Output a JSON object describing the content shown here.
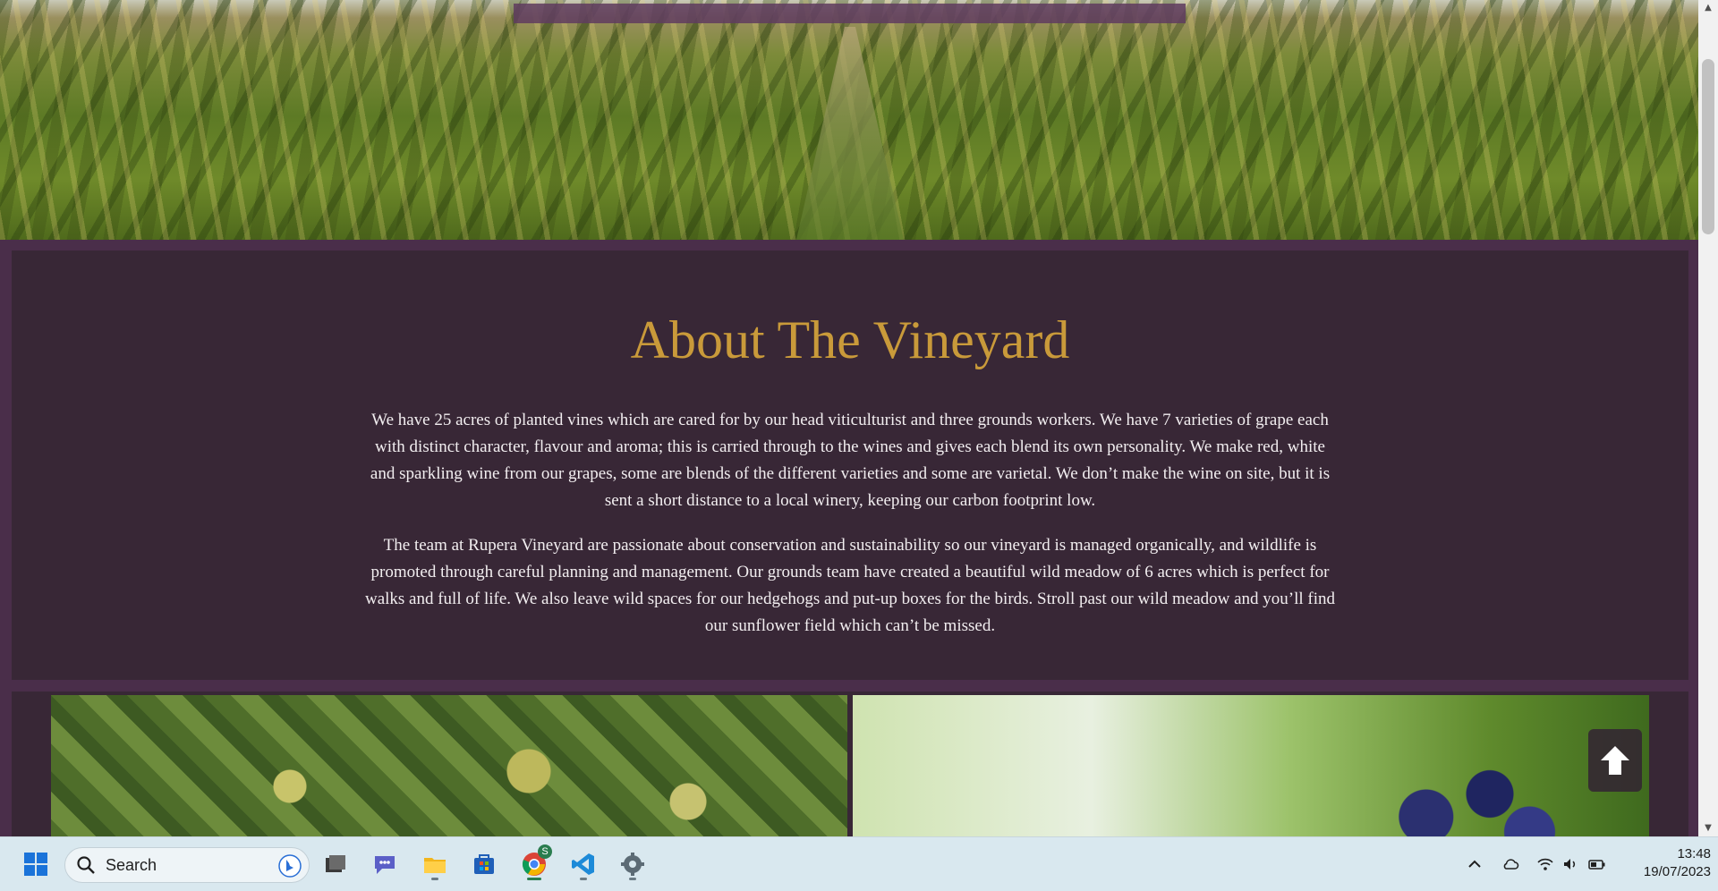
{
  "about": {
    "title": "About The Vineyard",
    "paragraph1": "We have 25 acres of planted vines which are cared for by our head viticulturist and three grounds workers. We have 7 varieties of grape each with distinct character, flavour and aroma; this is carried through to the wines and gives each blend its own personality. We make red, white and sparkling wine from our grapes, some are blends of the different varieties and some are varietal. We don’t make the wine on site, but it is sent a short distance to a local winery, keeping our carbon footprint low.",
    "paragraph2": "The team at Rupera Vineyard are passionate about conservation and sustainability so our vineyard is managed organically, and wildlife is promoted through careful planning and management. Our grounds team have created a beautiful wild meadow of 6 acres which is perfect for walks and full of life. We also leave wild spaces for our hedgehogs and put-up boxes for the birds. Stroll past our wild meadow and you’ll find our sunflower field which can’t be missed."
  },
  "colors": {
    "accent_gold": "#c99a3a",
    "panel": "#382736",
    "border_purple": "#4a2e4a"
  },
  "taskbar": {
    "search_placeholder": "Search",
    "time": "13:48",
    "date": "19/07/2023",
    "chrome_badge": "S",
    "apps": [
      "windows-start-icon",
      "task-view-icon",
      "teams-chat-icon",
      "file-explorer-icon",
      "microsoft-store-icon",
      "chrome-icon",
      "vscode-icon",
      "settings-icon"
    ],
    "tray": [
      "chevron-up-icon",
      "onedrive-cloud-icon",
      "wifi-icon",
      "volume-icon",
      "battery-icon"
    ]
  }
}
